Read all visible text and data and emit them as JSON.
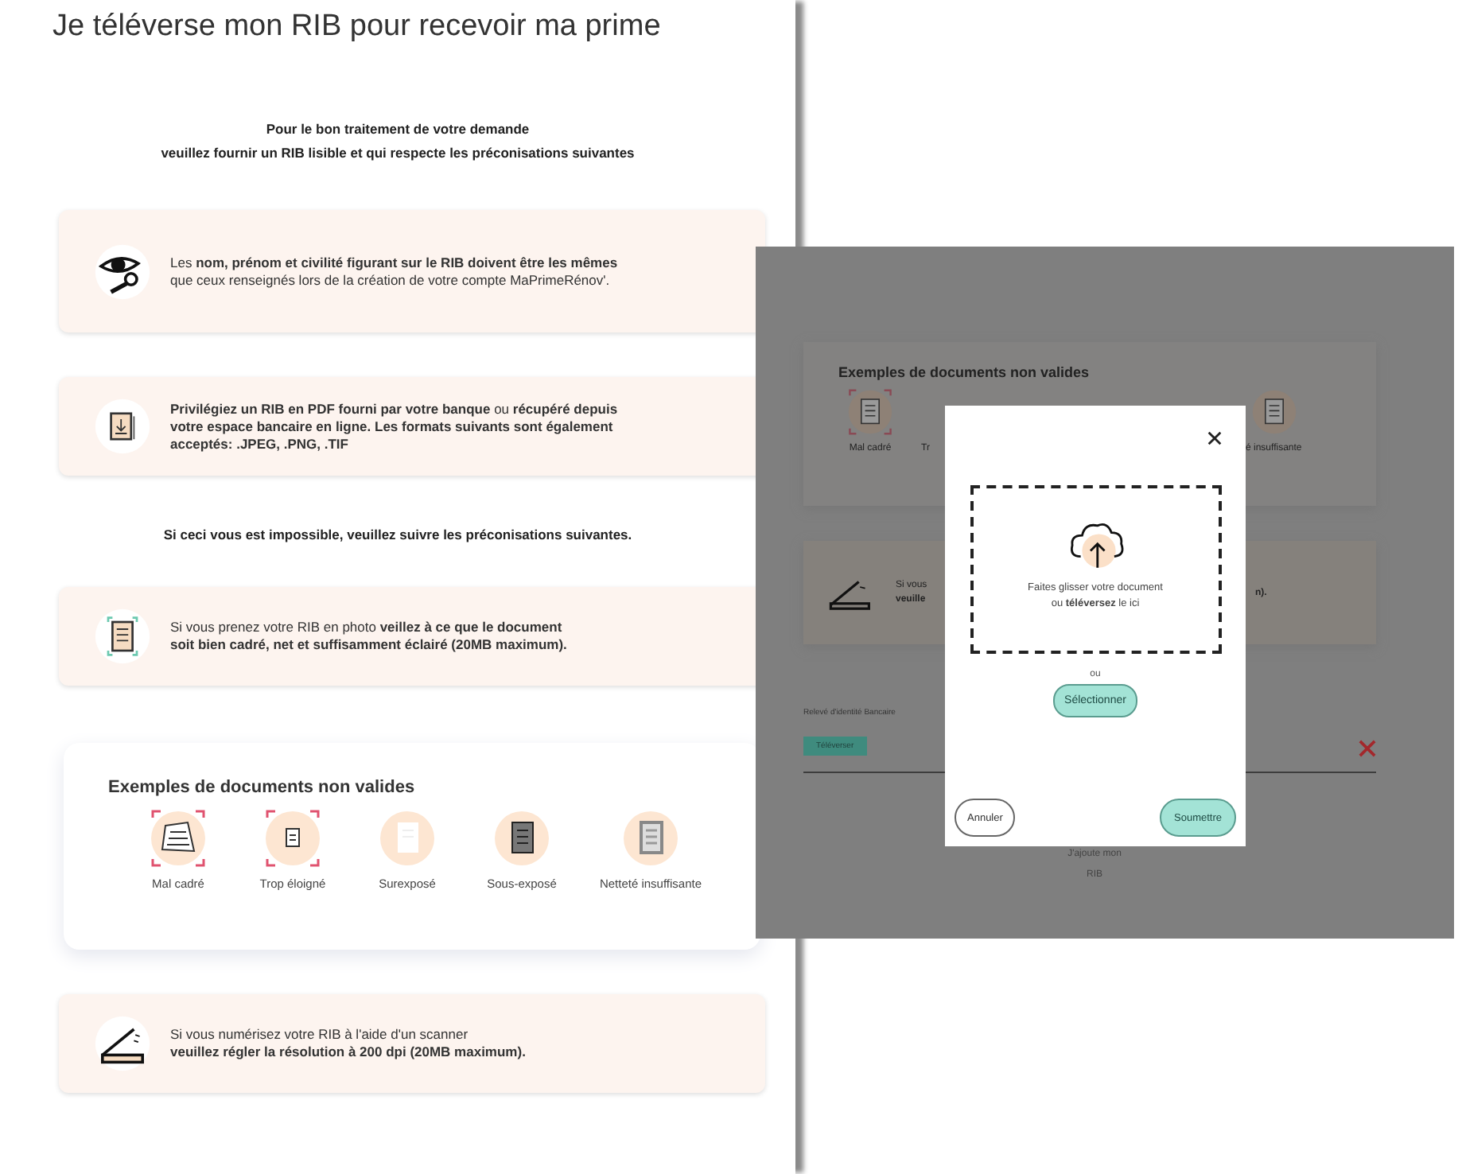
{
  "page": {
    "title": "Je téléverse mon RIB pour recevoir ma prime",
    "intro": "Pour le bon traitement de votre demande\nveuillez fournir un RIB lisible et qui respecte les préconisations suivantes",
    "blocks": [
      {
        "kind": "tip",
        "text": "Les **nom, prénom et civilité figurant sur le RIB doivent être les mêmes**\nque ceux renseignés lors de la création de votre compte MaPrimeRénov'."
      },
      {
        "kind": "tip",
        "text": "**Privilégiez un RIB en PDF fourni par votre banque** ou **récupéré depuis**\n**votre espace bancaire en ligne. Les formats suivants sont également**\n**acceptés: .JPEG, .PNG, .TIF**"
      },
      {
        "kind": "note",
        "text": "Si ceci vous est impossible, veuillez suivre les préconisations suivantes."
      },
      {
        "kind": "tip",
        "text": "Si vous prenez votre RIB en photo **veillez à ce que le document**\n**soit bien cadré, net et suffisamment éclairé (20MB maximum).**"
      },
      {
        "kind": "examples",
        "title": "Exemples de documents non valides",
        "items": [
          {
            "kind": "skewed",
            "label": "Mal cadré"
          },
          {
            "kind": "far",
            "label": "Trop éloigné"
          },
          {
            "kind": "over",
            "label": "Surexposé"
          },
          {
            "kind": "under",
            "label": "Sous-exposé"
          },
          {
            "kind": "blur",
            "label": "Netteté insuffisante"
          }
        ]
      },
      {
        "kind": "tip",
        "text": "Si vous numérisez votre RIB à l'aide d'un scanner\n**veuillez régler la résolution à 200 dpi (20MB maximum).**"
      }
    ]
  },
  "overlay": {
    "examples_title": "Exemples de documents non valides",
    "examples": [
      {
        "kind": "skewed",
        "label": "Mal cadré"
      },
      {
        "kind": "far",
        "label": "Tr"
      },
      {
        "kind": "blur",
        "label": "é insuffisante"
      }
    ],
    "scanner_text": "Si vous\n**veuille**",
    "scanner_tail": "**n).**",
    "field_label": "Relevé d'identité Bancaire",
    "upload_button": "Téléverser",
    "add_label": "J'ajoute mon\nRIB",
    "modal": {
      "drop_text": "Faites glisser votre document\nou **téléversez** le ici",
      "or": "ou",
      "select_button": "Sélectionner",
      "buttons": [
        {
          "kind": "secondary",
          "label": "Annuler"
        },
        {
          "kind": "primary",
          "label": "Soumettre"
        }
      ]
    }
  }
}
